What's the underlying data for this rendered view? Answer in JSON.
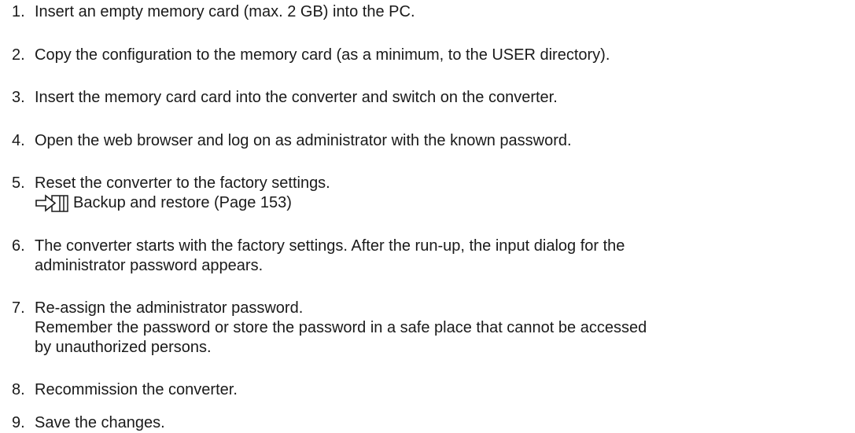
{
  "steps": [
    {
      "number": "1.",
      "lines": [
        "Insert an empty memory card (max. 2 GB) into the PC."
      ]
    },
    {
      "number": "2.",
      "lines": [
        "Copy the configuration to the memory card (as a minimum, to the USER directory)."
      ]
    },
    {
      "number": "3.",
      "lines": [
        "Insert the memory card card into the converter and switch on the converter."
      ]
    },
    {
      "number": "4.",
      "lines": [
        "Open the web browser and log on as administrator with the known password."
      ]
    },
    {
      "number": "5.",
      "lines": [
        "Reset the converter to the factory settings."
      ],
      "xref": {
        "icon": "cross-reference-arrow-icon",
        "text": "Backup and restore (Page 153)"
      }
    },
    {
      "number": "6.",
      "lines": [
        "The converter starts with the factory settings. After the run-up, the input dialog for the",
        "administrator password appears."
      ]
    },
    {
      "number": "7.",
      "lines": [
        "Re-assign the administrator password.",
        "Remember the password or store the password in a safe place that cannot be accessed",
        "by unauthorized persons."
      ]
    },
    {
      "number": "8.",
      "lines": [
        "Recommission the converter."
      ]
    },
    {
      "number": "9.",
      "lines": [
        "Save the changes."
      ]
    }
  ]
}
